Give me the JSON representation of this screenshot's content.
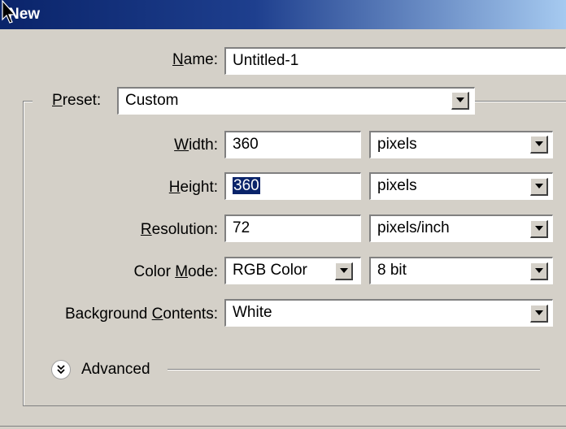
{
  "window": {
    "title": "New"
  },
  "name": {
    "label_ul": "N",
    "label_rest": "ame:",
    "value": "Untitled-1"
  },
  "preset": {
    "label_ul": "P",
    "label_rest": "reset:",
    "value": "Custom"
  },
  "width": {
    "label_ul": "W",
    "label_rest": "idth:",
    "value": "360",
    "unit": "pixels"
  },
  "height": {
    "label_ul": "H",
    "label_rest": "eight:",
    "value": "360",
    "unit": "pixels"
  },
  "resolution": {
    "label_ul": "R",
    "label_rest": "esolution:",
    "value": "72",
    "unit": "pixels/inch"
  },
  "color_mode": {
    "label_pre": "Color ",
    "label_ul": "M",
    "label_rest": "ode:",
    "value": "RGB Color",
    "depth": "8 bit"
  },
  "background": {
    "label_pre": "Background ",
    "label_ul": "C",
    "label_rest": "ontents:",
    "value": "White"
  },
  "advanced": {
    "label": "Advanced"
  },
  "icons": {
    "dropdown": "dropdown-arrow-icon",
    "expand": "chevron-double-down-icon",
    "cursor": "cursor-arrow-icon"
  }
}
